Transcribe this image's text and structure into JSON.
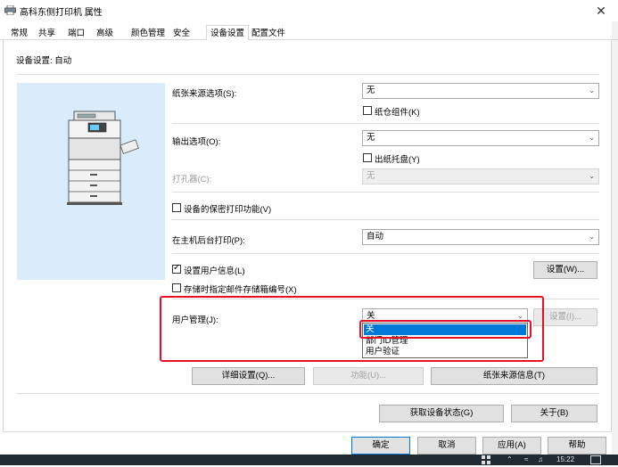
{
  "window": {
    "title": "高科东侧打印机 属性",
    "close_glyph": "✕"
  },
  "tabs": [
    {
      "label": "常规"
    },
    {
      "label": "共享"
    },
    {
      "label": "端口"
    },
    {
      "label": "高级"
    },
    {
      "label": "颜色管理"
    },
    {
      "label": "安全"
    },
    {
      "label": "设备设置",
      "active": true
    },
    {
      "label": "配置文件"
    }
  ],
  "device_settings": {
    "status": "设备设置: 自动"
  },
  "paper_source": {
    "label": "纸张来源选项(S):",
    "value": "无",
    "assembly_label": "纸仓组件(K)",
    "assembly_checked": false
  },
  "output": {
    "label": "输出选项(O):",
    "value": "无",
    "tray_label": "出纸托盘(Y)",
    "tray_checked": false
  },
  "punch": {
    "label": "打孔器(C):",
    "value": "无"
  },
  "secure_print": {
    "label": "设备的保密打印功能(V)",
    "checked": false
  },
  "background_print": {
    "label": "在主机后台打印(P):",
    "value": "自动"
  },
  "user_info": {
    "label": "设置用户信息(L)",
    "checked": true,
    "button": "设置(W)..."
  },
  "mailbox": {
    "label": "存储时指定邮件存储箱编号(X)",
    "checked": false
  },
  "user_management": {
    "label": "用户管理(J):",
    "value": "关",
    "button": "设置(I)...",
    "options": [
      {
        "label": "关",
        "selected": true
      },
      {
        "label": "部门ID管理",
        "selected": false
      },
      {
        "label": "用户验证",
        "selected": false
      }
    ]
  },
  "actions": {
    "details": "详细设置(Q)...",
    "function": "功能(U)...",
    "paper_source_info": "纸张来源信息(T)"
  },
  "bottom": {
    "get_status": "获取设备状态(G)",
    "about": "关于(B)"
  },
  "dialog": {
    "ok": "确定",
    "cancel": "取消",
    "apply": "应用(A)",
    "help": "帮助"
  },
  "taskbar": {
    "time": "15:22"
  },
  "colors": {
    "highlight_red": "#e81123",
    "selection_blue": "#0078d7",
    "printer_bg": "#d8ecfb"
  },
  "icons": [
    "printer-icon",
    "close-icon",
    "chevron-down-icon",
    "checkbox-icon",
    "printer-illustration"
  ]
}
